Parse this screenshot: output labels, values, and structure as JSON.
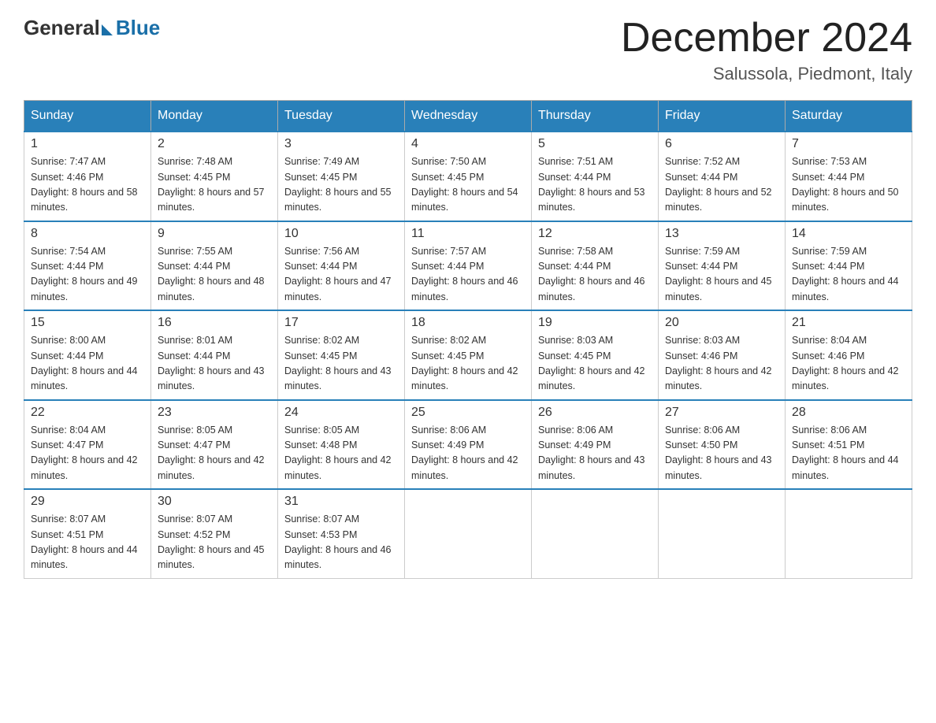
{
  "logo": {
    "general": "General",
    "blue": "Blue"
  },
  "title": "December 2024",
  "location": "Salussola, Piedmont, Italy",
  "days_of_week": [
    "Sunday",
    "Monday",
    "Tuesday",
    "Wednesday",
    "Thursday",
    "Friday",
    "Saturday"
  ],
  "weeks": [
    [
      {
        "day": "1",
        "sunrise": "7:47 AM",
        "sunset": "4:46 PM",
        "daylight": "8 hours and 58 minutes."
      },
      {
        "day": "2",
        "sunrise": "7:48 AM",
        "sunset": "4:45 PM",
        "daylight": "8 hours and 57 minutes."
      },
      {
        "day": "3",
        "sunrise": "7:49 AM",
        "sunset": "4:45 PM",
        "daylight": "8 hours and 55 minutes."
      },
      {
        "day": "4",
        "sunrise": "7:50 AM",
        "sunset": "4:45 PM",
        "daylight": "8 hours and 54 minutes."
      },
      {
        "day": "5",
        "sunrise": "7:51 AM",
        "sunset": "4:44 PM",
        "daylight": "8 hours and 53 minutes."
      },
      {
        "day": "6",
        "sunrise": "7:52 AM",
        "sunset": "4:44 PM",
        "daylight": "8 hours and 52 minutes."
      },
      {
        "day": "7",
        "sunrise": "7:53 AM",
        "sunset": "4:44 PM",
        "daylight": "8 hours and 50 minutes."
      }
    ],
    [
      {
        "day": "8",
        "sunrise": "7:54 AM",
        "sunset": "4:44 PM",
        "daylight": "8 hours and 49 minutes."
      },
      {
        "day": "9",
        "sunrise": "7:55 AM",
        "sunset": "4:44 PM",
        "daylight": "8 hours and 48 minutes."
      },
      {
        "day": "10",
        "sunrise": "7:56 AM",
        "sunset": "4:44 PM",
        "daylight": "8 hours and 47 minutes."
      },
      {
        "day": "11",
        "sunrise": "7:57 AM",
        "sunset": "4:44 PM",
        "daylight": "8 hours and 46 minutes."
      },
      {
        "day": "12",
        "sunrise": "7:58 AM",
        "sunset": "4:44 PM",
        "daylight": "8 hours and 46 minutes."
      },
      {
        "day": "13",
        "sunrise": "7:59 AM",
        "sunset": "4:44 PM",
        "daylight": "8 hours and 45 minutes."
      },
      {
        "day": "14",
        "sunrise": "7:59 AM",
        "sunset": "4:44 PM",
        "daylight": "8 hours and 44 minutes."
      }
    ],
    [
      {
        "day": "15",
        "sunrise": "8:00 AM",
        "sunset": "4:44 PM",
        "daylight": "8 hours and 44 minutes."
      },
      {
        "day": "16",
        "sunrise": "8:01 AM",
        "sunset": "4:44 PM",
        "daylight": "8 hours and 43 minutes."
      },
      {
        "day": "17",
        "sunrise": "8:02 AM",
        "sunset": "4:45 PM",
        "daylight": "8 hours and 43 minutes."
      },
      {
        "day": "18",
        "sunrise": "8:02 AM",
        "sunset": "4:45 PM",
        "daylight": "8 hours and 42 minutes."
      },
      {
        "day": "19",
        "sunrise": "8:03 AM",
        "sunset": "4:45 PM",
        "daylight": "8 hours and 42 minutes."
      },
      {
        "day": "20",
        "sunrise": "8:03 AM",
        "sunset": "4:46 PM",
        "daylight": "8 hours and 42 minutes."
      },
      {
        "day": "21",
        "sunrise": "8:04 AM",
        "sunset": "4:46 PM",
        "daylight": "8 hours and 42 minutes."
      }
    ],
    [
      {
        "day": "22",
        "sunrise": "8:04 AM",
        "sunset": "4:47 PM",
        "daylight": "8 hours and 42 minutes."
      },
      {
        "day": "23",
        "sunrise": "8:05 AM",
        "sunset": "4:47 PM",
        "daylight": "8 hours and 42 minutes."
      },
      {
        "day": "24",
        "sunrise": "8:05 AM",
        "sunset": "4:48 PM",
        "daylight": "8 hours and 42 minutes."
      },
      {
        "day": "25",
        "sunrise": "8:06 AM",
        "sunset": "4:49 PM",
        "daylight": "8 hours and 42 minutes."
      },
      {
        "day": "26",
        "sunrise": "8:06 AM",
        "sunset": "4:49 PM",
        "daylight": "8 hours and 43 minutes."
      },
      {
        "day": "27",
        "sunrise": "8:06 AM",
        "sunset": "4:50 PM",
        "daylight": "8 hours and 43 minutes."
      },
      {
        "day": "28",
        "sunrise": "8:06 AM",
        "sunset": "4:51 PM",
        "daylight": "8 hours and 44 minutes."
      }
    ],
    [
      {
        "day": "29",
        "sunrise": "8:07 AM",
        "sunset": "4:51 PM",
        "daylight": "8 hours and 44 minutes."
      },
      {
        "day": "30",
        "sunrise": "8:07 AM",
        "sunset": "4:52 PM",
        "daylight": "8 hours and 45 minutes."
      },
      {
        "day": "31",
        "sunrise": "8:07 AM",
        "sunset": "4:53 PM",
        "daylight": "8 hours and 46 minutes."
      },
      null,
      null,
      null,
      null
    ]
  ],
  "colors": {
    "header_bg": "#2980b9",
    "header_text": "#ffffff",
    "border": "#aaaaaa",
    "cell_border": "#cccccc",
    "text": "#333333"
  }
}
